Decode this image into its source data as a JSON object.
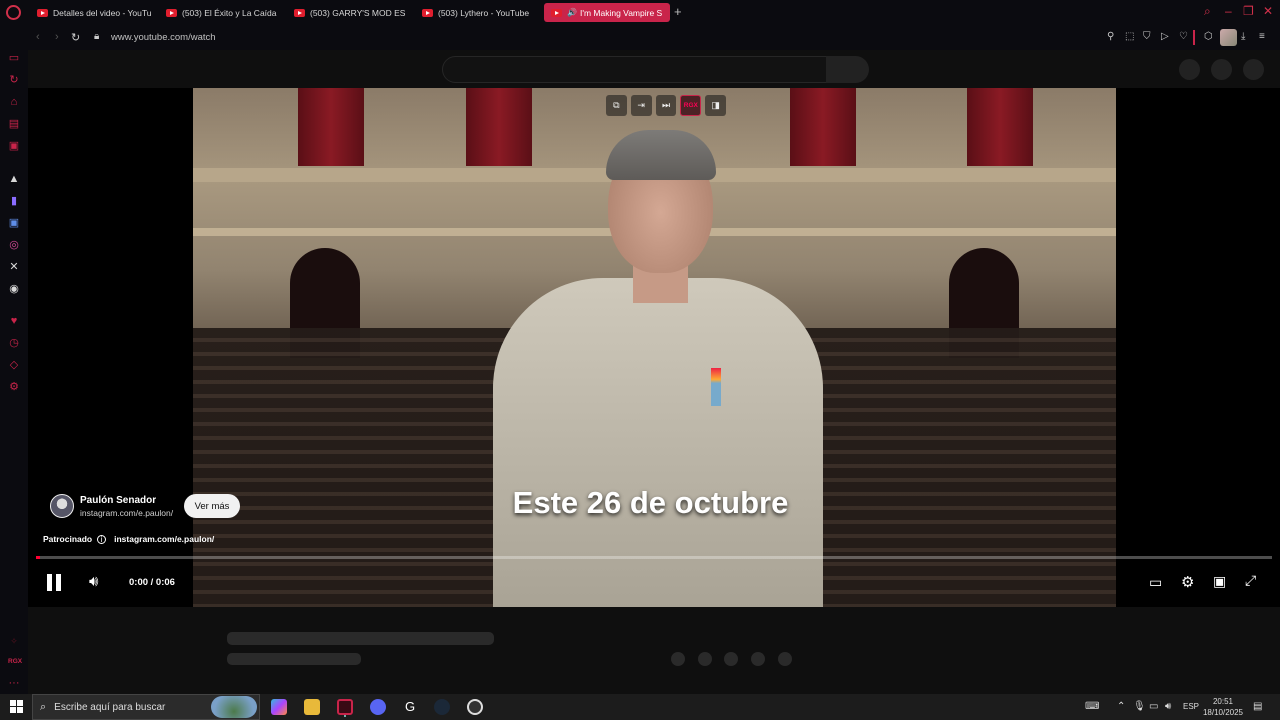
{
  "browser": {
    "tabs": [
      {
        "label": "Detalles del video - YouTu"
      },
      {
        "label": "(503) El Éxito y La Caída"
      },
      {
        "label": "(503) GARRY'S MOD ES"
      },
      {
        "label": "(503) Lythero - YouTube"
      },
      {
        "label": "I'm Making Vampire S",
        "active": true
      }
    ],
    "new_tab": "+",
    "url": "www.youtube.com/watch",
    "accent": "#c9244a"
  },
  "player": {
    "caption": "Este 26 de octubre",
    "tools": {
      "rgx": "RGX"
    },
    "ad": {
      "name": "Paulón Senador",
      "link": "instagram.com/e.paulon/",
      "cta": "Ver más",
      "sponsored": "Patrocinado",
      "sponsored_link": "instagram.com/e.paulon/"
    },
    "time": "0:00 / 0:06",
    "progress": 0.002,
    "progress_color": "#ff0033"
  },
  "taskbar": {
    "search_placeholder": "Escribe aquí para buscar",
    "lang": "ESP",
    "time": "20:51",
    "date": "18/10/2025"
  },
  "sidebar": {
    "bottom_label": "RGX"
  }
}
